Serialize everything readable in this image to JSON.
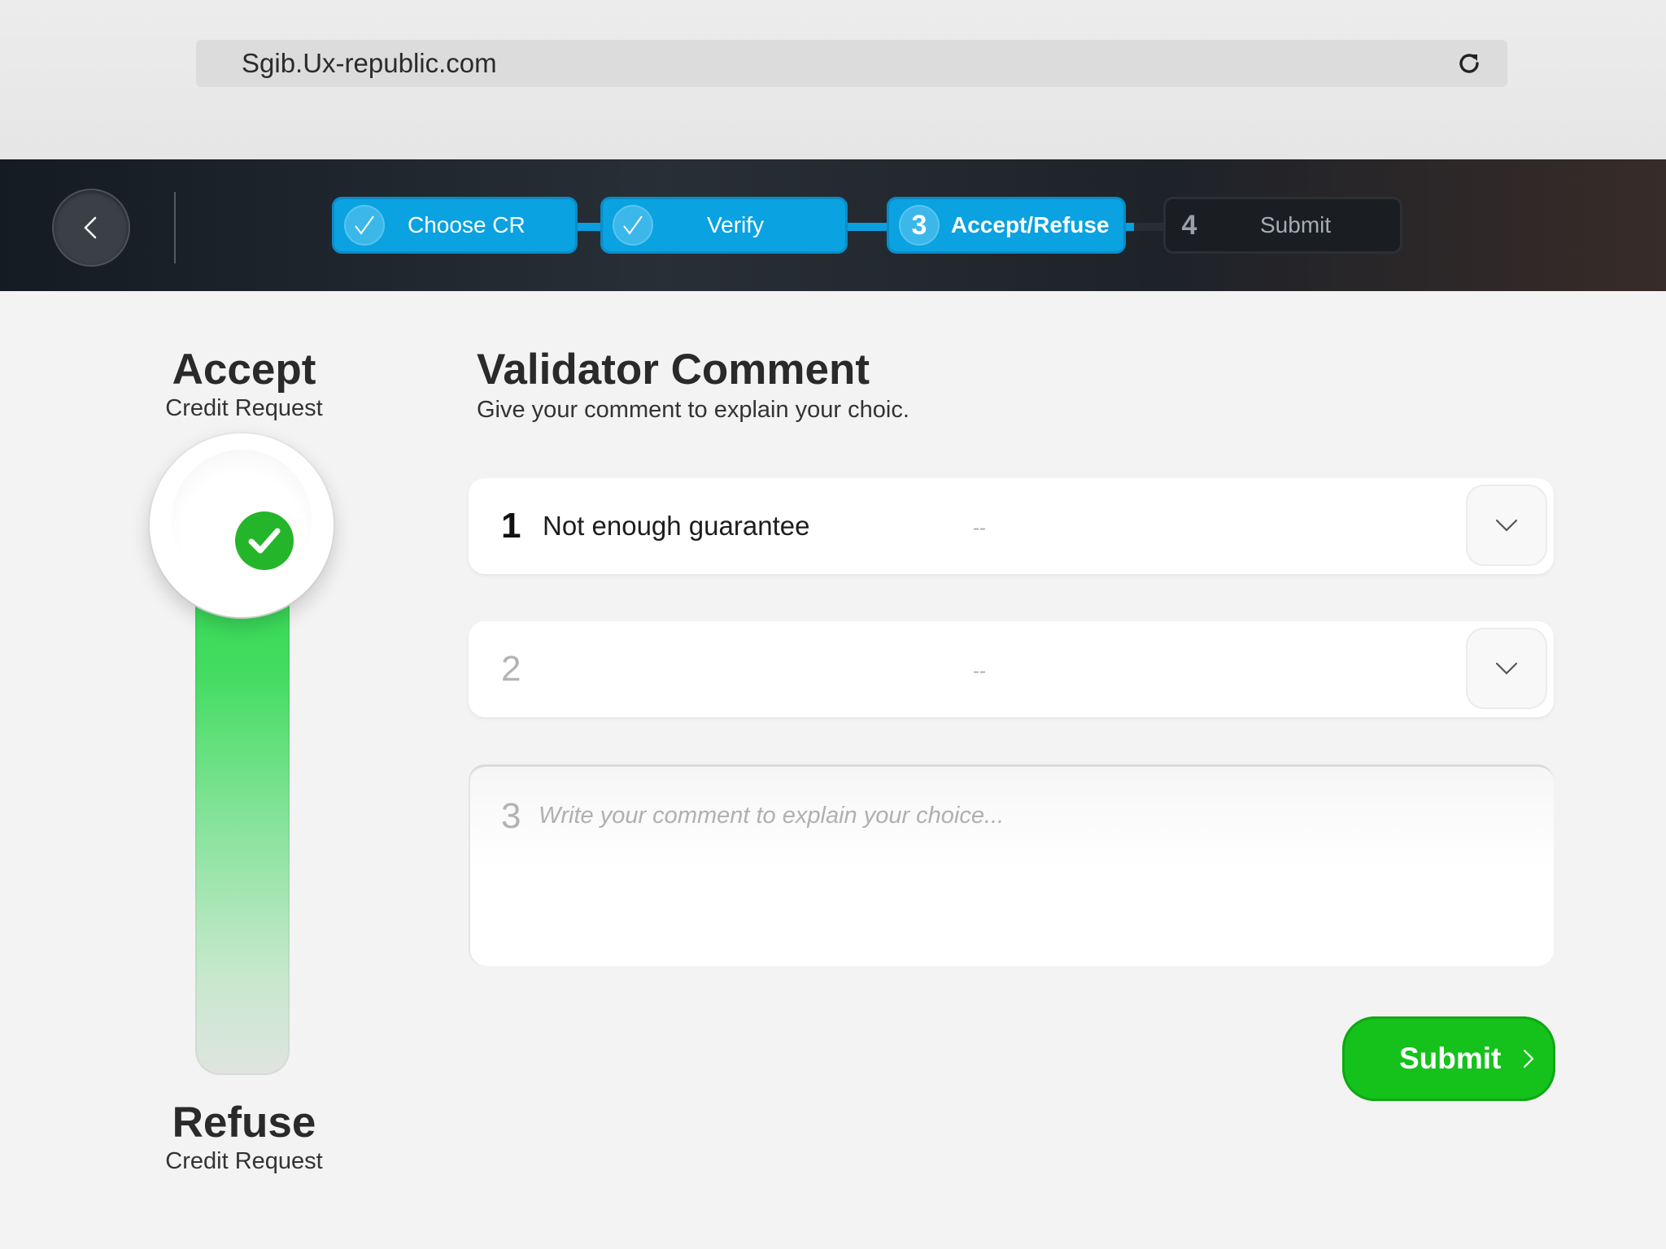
{
  "browser": {
    "url": "Sgib.Ux-republic.com",
    "reload_icon": "reload-icon"
  },
  "stepper": {
    "back_icon": "chevron-left-icon",
    "steps": [
      {
        "label": "Choose CR",
        "state": "completed",
        "icon": "check-icon"
      },
      {
        "label": "Verify",
        "state": "completed",
        "icon": "check-icon"
      },
      {
        "number": "3",
        "label": "Accept/Refuse",
        "state": "active"
      },
      {
        "number": "4",
        "label": "Submit",
        "state": "pending"
      }
    ],
    "accent_color": "#0aa2e0"
  },
  "decision": {
    "accept_title": "Accept",
    "accept_subtitle": "Credit Request",
    "refuse_title": "Refuse",
    "refuse_subtitle": "Credit Request",
    "selected": "Accept",
    "knob_icon": "check-circle-icon",
    "accept_color": "#25b52a"
  },
  "form": {
    "title": "Validator Comment",
    "subtitle": "Give your comment to explain your choic.",
    "rows": [
      {
        "number": "1",
        "value": "Not enough guarantee",
        "placeholder": "--"
      },
      {
        "number": "2",
        "value": "",
        "placeholder": "--"
      }
    ],
    "comment": {
      "number": "3",
      "placeholder": "Write your comment to explain your choice...",
      "value": ""
    },
    "submit_label": "Submit",
    "submit_color": "#15c21b"
  }
}
